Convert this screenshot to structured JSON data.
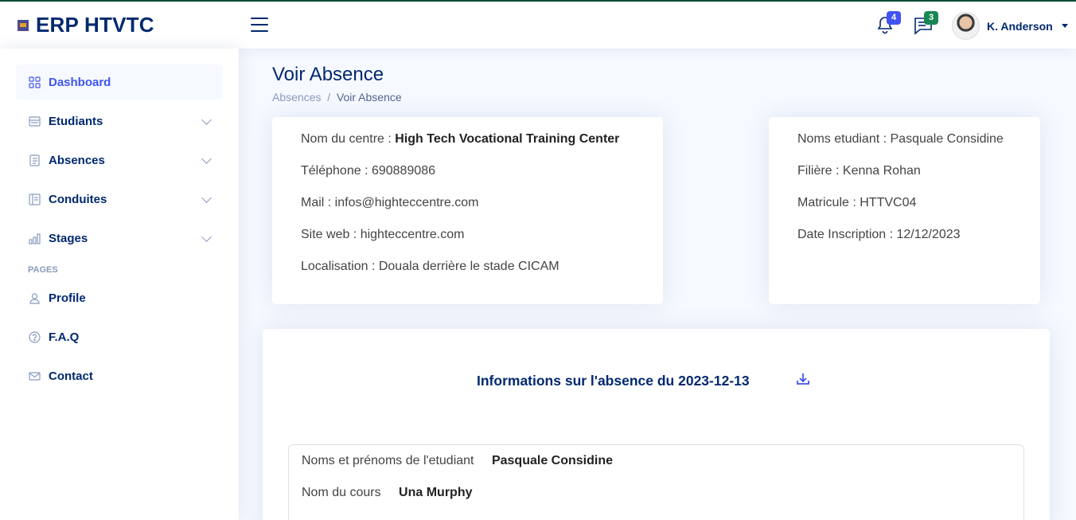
{
  "app": {
    "title": "ERP HTVTC"
  },
  "header": {
    "notifications_count": "4",
    "messages_count": "3",
    "user_name": "K. Anderson"
  },
  "sidebar": {
    "items": [
      {
        "label": "Dashboard",
        "icon": "grid-icon"
      },
      {
        "label": "Etudiants",
        "icon": "menu-button-icon"
      },
      {
        "label": "Absences",
        "icon": "journal-text-icon"
      },
      {
        "label": "Conduites",
        "icon": "layout-text-icon"
      },
      {
        "label": "Stages",
        "icon": "bar-chart-icon"
      }
    ],
    "heading": "PAGES",
    "pages": [
      {
        "label": "Profile",
        "icon": "person-icon"
      },
      {
        "label": "F.A.Q",
        "icon": "question-circle-icon"
      },
      {
        "label": "Contact",
        "icon": "envelope-icon"
      }
    ]
  },
  "page": {
    "title": "Voir Absence",
    "breadcrumb": [
      "Absences",
      "Voir Absence"
    ]
  },
  "centre": {
    "name_label": "Nom du centre :",
    "name_value": "High Tech Vocational Training Center",
    "phone": "Téléphone : 690889086",
    "mail": "Mail : infos@highteccentre.com",
    "site": "Site web : highteccentre.com",
    "location": "Localisation : Douala derrière le stade CICAM"
  },
  "student": {
    "name": "Noms etudiant : Pasquale Considine",
    "filiere": "Filière : Kenna Rohan",
    "matricule": "Matricule : HTTVC04",
    "inscription": "Date Inscription : 12/12/2023"
  },
  "absence": {
    "title": "Informations sur l'absence du 2023-12-13",
    "student_label": "Noms et prénoms de l'etudiant",
    "student_value": "Pasquale Considine",
    "course_label": "Nom du cours",
    "course_value": "Una Murphy"
  },
  "colors": {
    "primary": "#012970",
    "accent": "#4154f1",
    "success": "#198754"
  }
}
